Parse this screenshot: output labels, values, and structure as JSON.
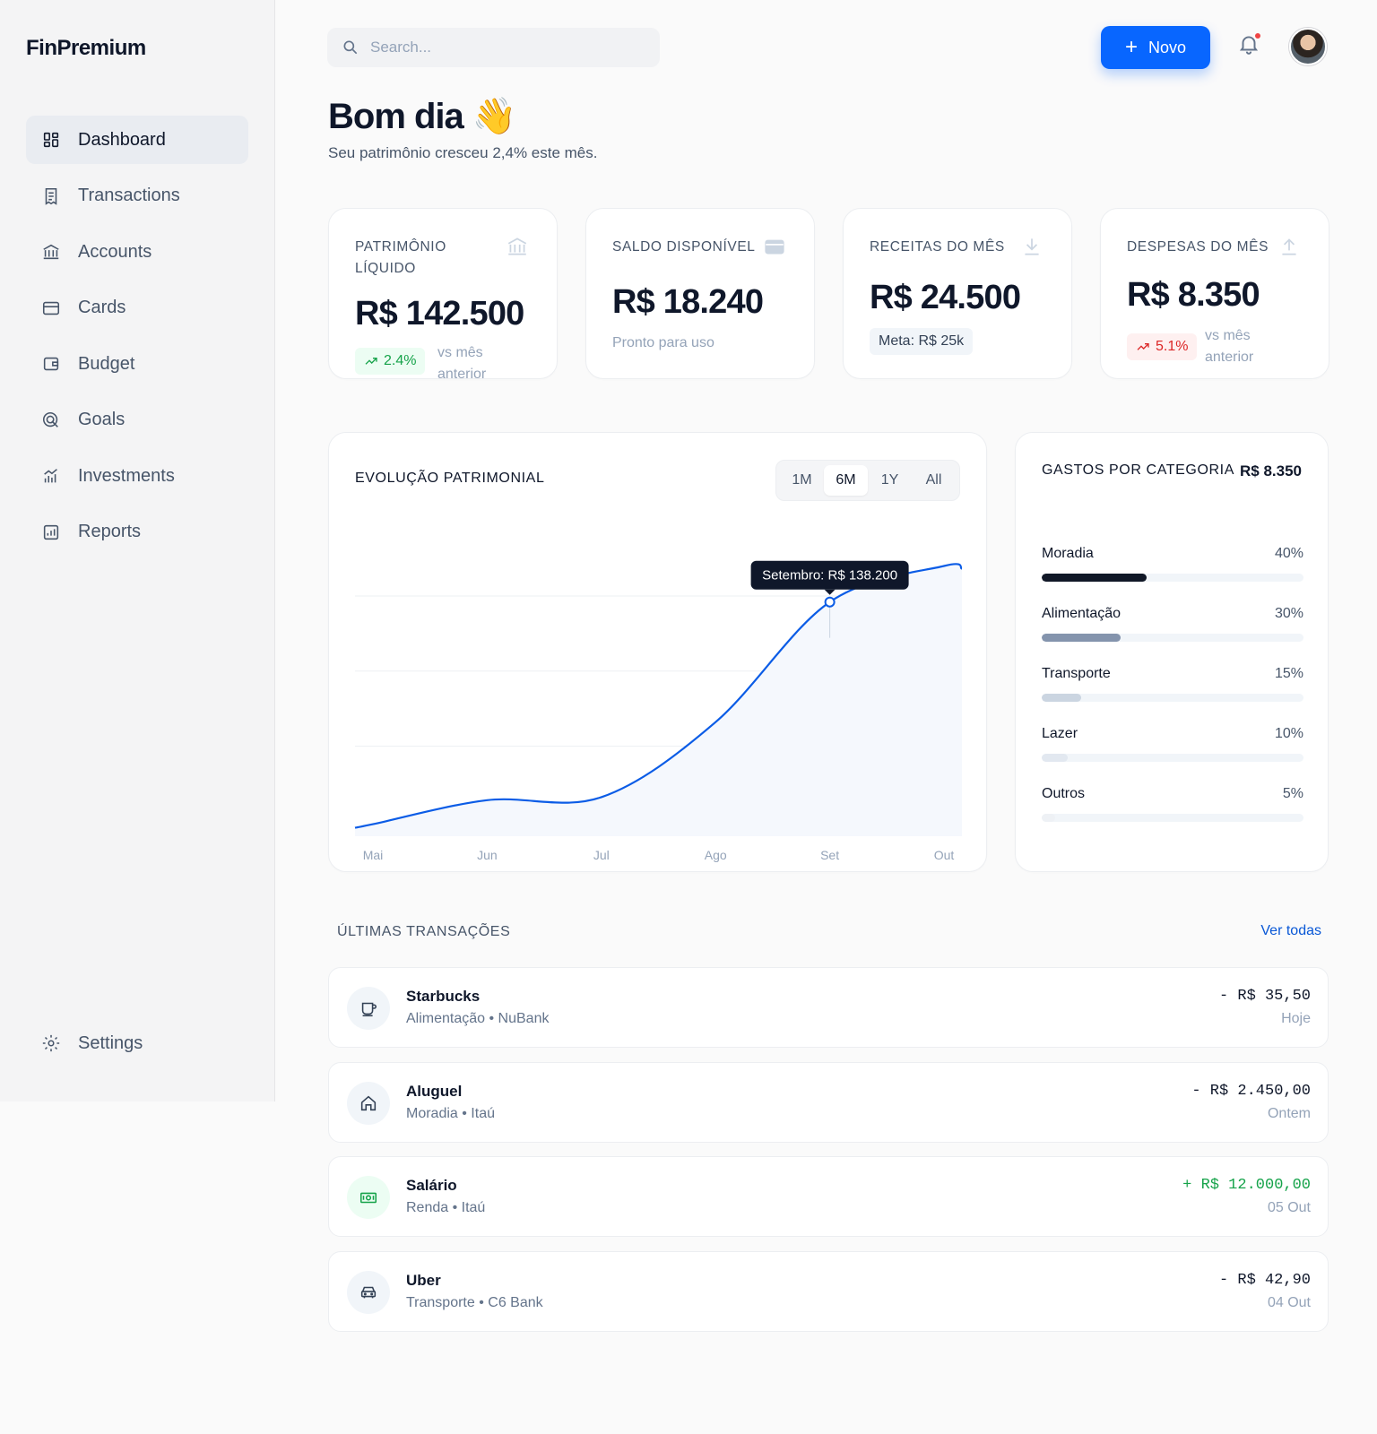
{
  "brand": "FinPremium",
  "nav": [
    {
      "label": "Dashboard",
      "icon": "dashboard-icon",
      "active": true
    },
    {
      "label": "Transactions",
      "icon": "receipt-icon"
    },
    {
      "label": "Accounts",
      "icon": "bank-icon"
    },
    {
      "label": "Cards",
      "icon": "credit-card-icon"
    },
    {
      "label": "Budget",
      "icon": "wallet-icon"
    },
    {
      "label": "Goals",
      "icon": "target-icon"
    },
    {
      "label": "Investments",
      "icon": "bar-chart-icon"
    },
    {
      "label": "Reports",
      "icon": "report-icon"
    }
  ],
  "settings_label": "Settings",
  "search": {
    "placeholder": "Search..."
  },
  "new_button": {
    "label": "Novo"
  },
  "greeting": {
    "title": "Bom dia 👋",
    "subtitle": "Seu patrimônio cresceu 2,4% este mês."
  },
  "kpis": [
    {
      "label": "PATRIMÔNIO LÍQUIDO",
      "value": "R$ 142.500",
      "badge": "2.4%",
      "note": "vs mês anterior",
      "icon": "bank-icon",
      "trend": "up"
    },
    {
      "label": "SALDO DISPONÍVEL",
      "value": "R$ 18.240",
      "note": "Pronto para uso",
      "icon": "card-icon"
    },
    {
      "label": "RECEITAS DO MÊS",
      "value": "R$ 24.500",
      "badge": "Meta: R$ 25k",
      "icon": "download-icon"
    },
    {
      "label": "DESPESAS DO MÊS",
      "value": "R$ 8.350",
      "badge": "5.1%",
      "note": "vs mês anterior",
      "icon": "upload-icon",
      "trend": "down"
    }
  ],
  "evolution": {
    "title": "EVOLUÇÃO PATRIMONIAL",
    "ranges": [
      "1M",
      "6M",
      "1Y",
      "All"
    ],
    "selected_range": "6M",
    "tooltip": "Setembro: R$ 138.200"
  },
  "chart_data": {
    "type": "area",
    "title": "EVOLUÇÃO PATRIMONIAL",
    "categories": [
      "Mai",
      "Jun",
      "Jul",
      "Ago",
      "Set",
      "Out"
    ],
    "series": [
      {
        "values": [
          0.04,
          0.12,
          0.13,
          0.38,
          0.78,
          0.9
        ]
      }
    ],
    "highlight": {
      "label": "Setembro: R$ 138.200"
    },
    "ylim": [
      0,
      1
    ],
    "grid": true,
    "line_color": "#0b5ce6"
  },
  "categories": {
    "title": "GASTOS POR CATEGORIA",
    "total": "R$ 8.350",
    "items": [
      {
        "name": "Moradia",
        "pct": "40%",
        "value": 0.4,
        "color": "#111827"
      },
      {
        "name": "Alimentação",
        "pct": "30%",
        "value": 0.3,
        "color": "#8494ad"
      },
      {
        "name": "Transporte",
        "pct": "15%",
        "value": 0.15,
        "color": "#cbd5e1"
      },
      {
        "name": "Lazer",
        "pct": "10%",
        "value": 0.1,
        "color": "#e2e8f0"
      },
      {
        "name": "Outros",
        "pct": "5%",
        "value": 0.05,
        "color": "#eef1f5"
      }
    ]
  },
  "transactions": {
    "title": "ÚLTIMAS TRANSAÇÕES",
    "see_all": "Ver todas",
    "items": [
      {
        "name": "Starbucks",
        "sub": "Alimentação • NuBank",
        "amount": "- R$ 35,50",
        "date": "Hoje",
        "icon": "coffee-icon",
        "positive": false
      },
      {
        "name": "Aluguel",
        "sub": "Moradia • Itaú",
        "amount": "- R$ 2.450,00",
        "date": "Ontem",
        "icon": "home-icon",
        "positive": false
      },
      {
        "name": "Salário",
        "sub": "Renda • Itaú",
        "amount": "+ R$ 12.000,00",
        "date": "05 Out",
        "icon": "cash-icon",
        "positive": true
      },
      {
        "name": "Uber",
        "sub": "Transporte • C6 Bank",
        "amount": "- R$ 42,90",
        "date": "04 Out",
        "icon": "car-icon",
        "positive": false
      }
    ]
  }
}
